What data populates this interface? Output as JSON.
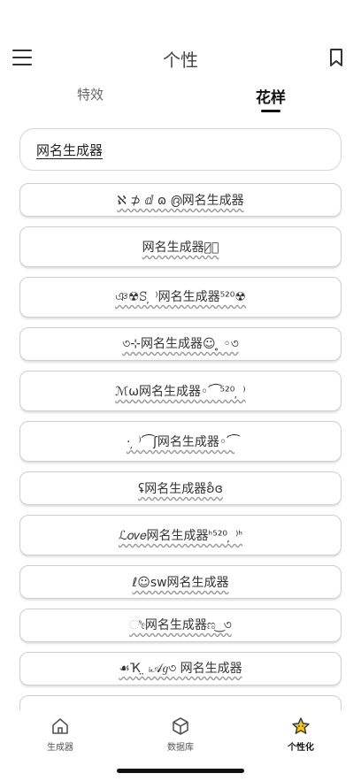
{
  "header": {
    "title": "个性"
  },
  "tabs": [
    {
      "label": "特效"
    },
    {
      "label": "花样"
    }
  ],
  "search": {
    "value": "网名生成器"
  },
  "items": [
    {
      "text": "ℵ ⊅ ⅆ ɷ ൫网名生成器"
    },
    {
      "text": "网名生成器ঌ̷ঁ"
    },
    {
      "text": "ঞ☢ꕶ ̦ ⁾网名生成器⁵²⁰☢"
    },
    {
      "text": "৩⊹网名生成器☺ ̥ ◦৩"
    },
    {
      "text": "ℳ⍵网名生成器◦ ́ ͡ ⁵²⁰ ̦ ⁾"
    },
    {
      "text": "· ̦ ⁾ ́ ͡ ʃ网名生成器◦ ́ ͡"
    },
    {
      "text": "ʢ网名生成器ʚ̊ɞ"
    },
    {
      "text": "ℒ𝑜𝑣𝑒网名生成器ᑋ⁵²⁰ ̦ ⁾ᑋ"
    },
    {
      "text": "ℓ☺sw网名生成器"
    },
    {
      "text": "ೀ网名生成器ಣ ͜ ৩"
    },
    {
      "text": "☙Ҡ ̤ ᵢ𝒜𝑔৩  网名生成器"
    },
    {
      "text": ""
    }
  ],
  "nav": [
    {
      "label": "生成器",
      "icon": "home-icon"
    },
    {
      "label": "数据库",
      "icon": "cube-icon"
    },
    {
      "label": "个性化",
      "icon": "star-icon"
    }
  ],
  "colors": {
    "accent": "#f5c518",
    "text": "#333333"
  }
}
